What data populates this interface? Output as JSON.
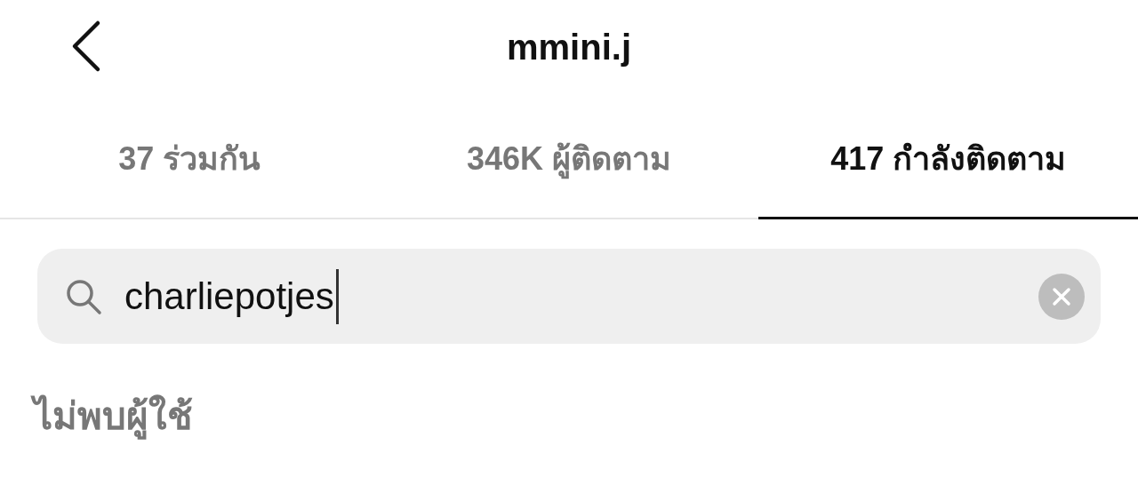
{
  "header": {
    "title": "mmini.j"
  },
  "tabs": [
    {
      "label": "37 ร่วมกัน",
      "selected": false
    },
    {
      "label": "346K ผู้ติดตาม",
      "selected": false
    },
    {
      "label": "417 กำลังติดตาม",
      "selected": true
    }
  ],
  "search": {
    "value": "charliepotjes",
    "focused": true
  },
  "message": "ไม่พบผู้ใช้"
}
